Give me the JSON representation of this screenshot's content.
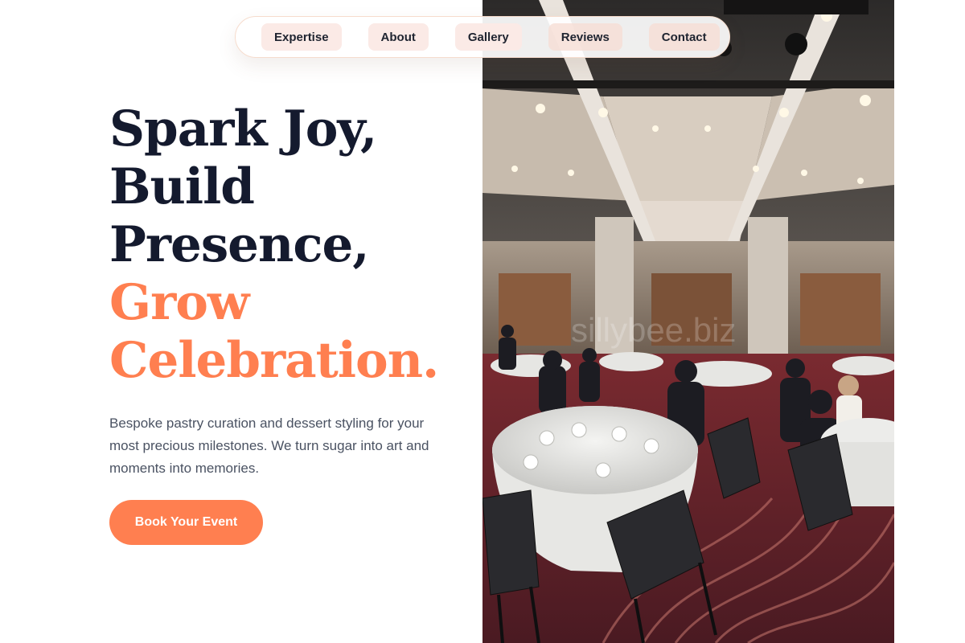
{
  "nav": {
    "items": [
      {
        "label": "Expertise"
      },
      {
        "label": "About"
      },
      {
        "label": "Gallery"
      },
      {
        "label": "Reviews"
      },
      {
        "label": "Contact"
      }
    ]
  },
  "hero": {
    "headline_lines": [
      "Spark Joy,",
      "Build",
      "Presence,"
    ],
    "accent_lines": [
      "Grow",
      "Celebration."
    ],
    "subtitle": "Bespoke pastry curation and dessert styling for your most precious milestones. We turn sugar into art and moments into memories.",
    "cta_label": "Book Your Event"
  },
  "photo": {
    "watermark": "sillybee.biz",
    "icon": "ballroom-event-photo"
  },
  "colors": {
    "accent": "#ff7f50",
    "heading": "#141a2e",
    "body_text": "#4a5262",
    "nav_item_bg": "#fbeae6"
  }
}
